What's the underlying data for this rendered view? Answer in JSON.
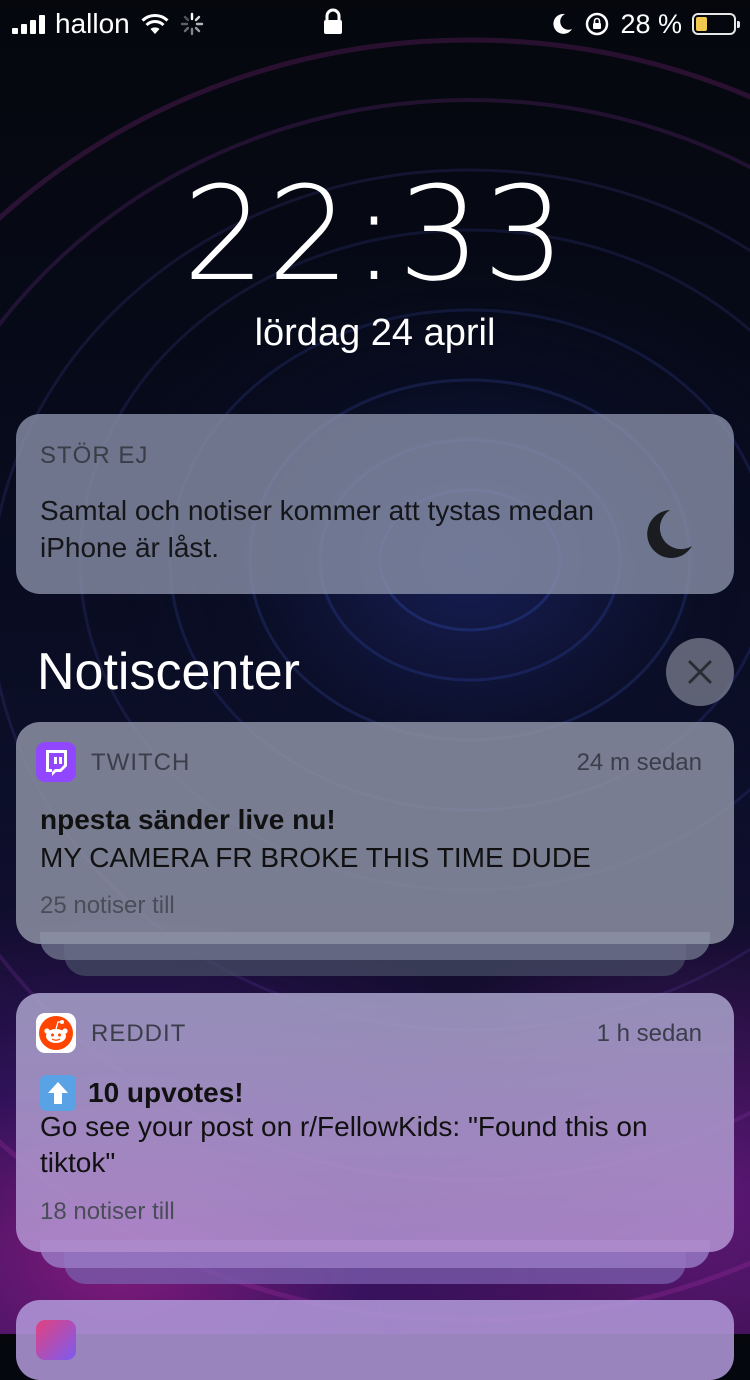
{
  "status_bar": {
    "carrier": "hallon",
    "battery_text": "28 %",
    "battery_level": 0.28,
    "icons": [
      "signal-icon",
      "wifi-icon",
      "activity-spinner-icon",
      "lock-icon",
      "moon-icon",
      "rotation-lock-icon",
      "battery-icon"
    ]
  },
  "lock_screen": {
    "time": "22:33",
    "date": "lördag 24 april"
  },
  "do_not_disturb": {
    "title": "STÖR EJ",
    "text": "Samtal och notiser kommer att tystas medan iPhone är låst.",
    "icon": "moon-icon"
  },
  "notification_center": {
    "title": "Notiscenter",
    "clear_icon": "close-icon"
  },
  "notifications": [
    {
      "app": "TWITCH",
      "time": "24 m sedan",
      "title": "npesta sänder live nu!",
      "body": "MY CAMERA FR BROKE THIS TIME DUDE",
      "more": "25 notiser till",
      "accent": "#9146ff"
    },
    {
      "app": "REDDIT",
      "time": "1 h sedan",
      "title_emoji": "⬆️",
      "title": "10 upvotes!",
      "body": "Go see your post on r/FellowKids: \"Found this on tiktok\"",
      "more": "18 notiser till",
      "accent": "#ff4500"
    }
  ],
  "colors": {
    "battery_fill": "#f2c94c",
    "twitch": "#9146ff",
    "reddit": "#ff4500"
  }
}
